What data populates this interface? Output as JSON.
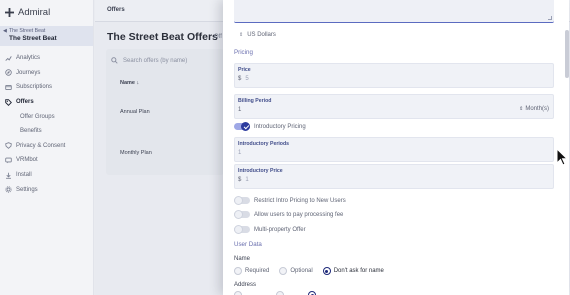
{
  "app": {
    "brand": "Admiral"
  },
  "property": {
    "small": "The Street Beat",
    "name": "The Street Beat"
  },
  "sidebar": {
    "items": [
      {
        "label": "Analytics",
        "icon": "analytics-icon"
      },
      {
        "label": "Journeys",
        "icon": "journeys-icon"
      },
      {
        "label": "Subscriptions",
        "icon": "subscriptions-icon"
      },
      {
        "label": "Offers",
        "icon": "offers-icon",
        "active": true
      },
      {
        "label": "Offer Groups",
        "sub": true
      },
      {
        "label": "Benefits",
        "sub": true
      },
      {
        "label": "Privacy & Consent",
        "icon": "privacy-icon"
      },
      {
        "label": "VRMbot",
        "icon": "vrmbot-icon"
      },
      {
        "label": "Install",
        "icon": "install-icon"
      },
      {
        "label": "Settings",
        "icon": "settings-icon"
      }
    ]
  },
  "main": {
    "breadcrumb": "Offers",
    "title": "The Street Beat Offers",
    "title_tail": "Off",
    "search_placeholder": "Search offers (by name)",
    "column_header": "Name ↓",
    "rows": [
      "Annual Plan",
      "Monthly Plan"
    ]
  },
  "panel": {
    "currency": "US Dollars",
    "pricing_label": "Pricing",
    "price": {
      "label": "Price",
      "symbol": "$",
      "value": "5"
    },
    "billing": {
      "label": "Billing Period",
      "value": "1",
      "unit": "Month(s)"
    },
    "intro_toggle_label": "Introductory Pricing",
    "intro_toggle_on": true,
    "intro_periods": {
      "label": "Introductory Periods",
      "value": "1"
    },
    "intro_price": {
      "label": "Introductory Price",
      "symbol": "$",
      "value": "1"
    },
    "toggles": [
      {
        "label": "Restrict Intro Pricing to New Users"
      },
      {
        "label": "Allow users to pay processing fee"
      },
      {
        "label": "Multi-property Offer"
      }
    ],
    "user_data_label": "User Data",
    "name_label": "Name",
    "name_options": [
      "Required",
      "Optional",
      "Don't ask for name"
    ],
    "name_selected": "Don't ask for name",
    "address_label": "Address"
  },
  "colors": {
    "accent": "#2c3b9e",
    "section": "#6a6fae",
    "sidebar_bg": "#f3f4f7"
  }
}
